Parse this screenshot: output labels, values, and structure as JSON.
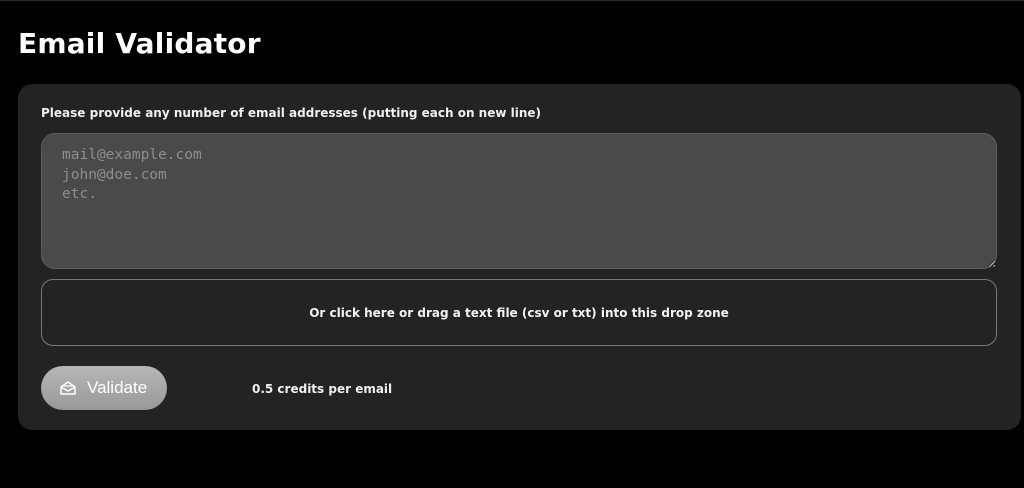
{
  "page": {
    "title": "Email Validator"
  },
  "form": {
    "label": "Please provide any number of email addresses (putting each on new line)",
    "textarea_placeholder": "mail@example.com\njohn@doe.com\netc.",
    "textarea_value": "",
    "drop_zone_text": "Or click here or drag a text file (csv or txt) into this drop zone",
    "validate_label": "Validate",
    "validate_icon": "envelope-open-icon",
    "credits_text": "0.5 credits per email"
  },
  "colors": {
    "background": "#000000",
    "card": "#232323",
    "textarea": "#4a4a4a",
    "button": "#a8a8a8"
  }
}
